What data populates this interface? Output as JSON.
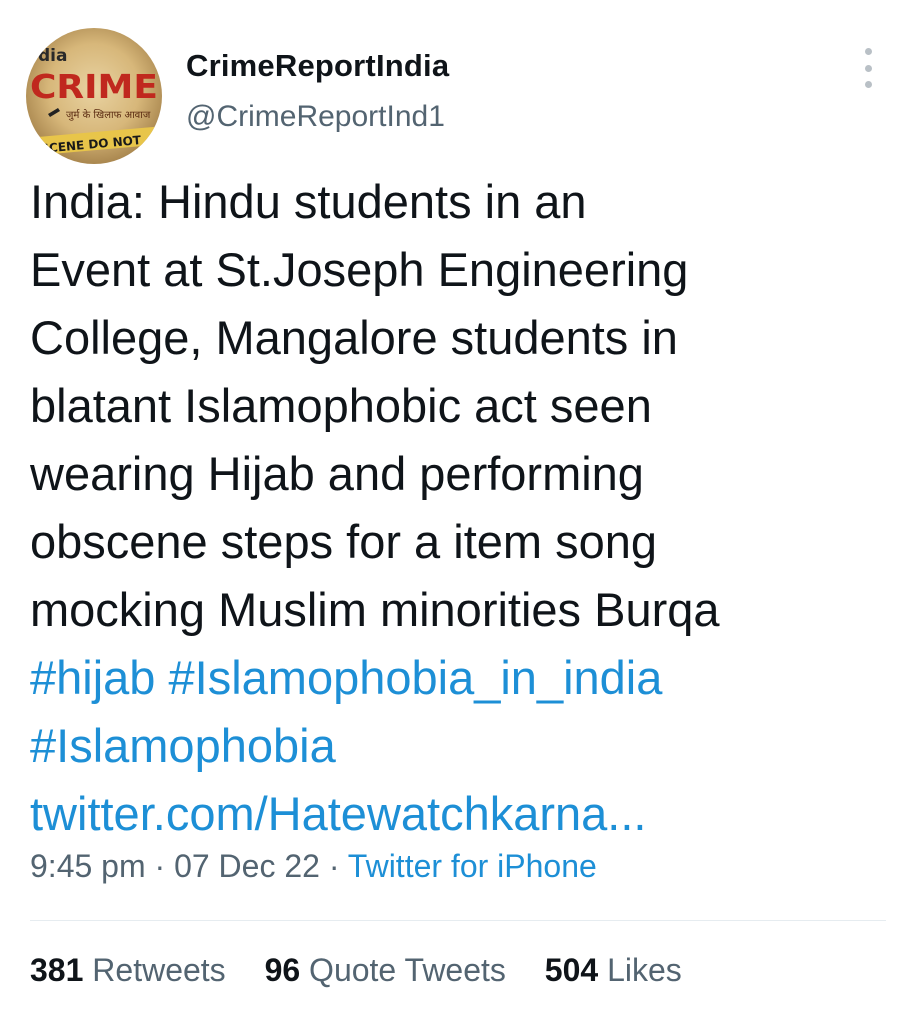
{
  "author": {
    "name": "CrimeReportIndia",
    "handle": "@CrimeReportInd1",
    "avatar": {
      "top_text": "dia",
      "logo_text": "CRIME",
      "tagline": "जुर्म के खिलाफ आवाज",
      "tape_text": "SCENE DO NOT"
    }
  },
  "tweet": {
    "lines": [
      "India: Hindu students in an",
      "Event at St.Joseph Engineering",
      "College, Mangalore students in",
      "blatant Islamophobic act seen",
      "wearing Hijab and performing",
      "obscene steps for a item song",
      "mocking Muslim minorities Burqa"
    ],
    "hashtags": [
      "#hijab",
      "#Islamophobia_in_india",
      "#Islamophobia"
    ],
    "link": "twitter.com/Hatewatchkarna..."
  },
  "meta": {
    "time": "9:45 pm",
    "separator": "·",
    "date": "07 Dec 22",
    "source": "Twitter for iPhone"
  },
  "stats": {
    "retweets_count": "381",
    "retweets_label": "Retweets",
    "quotes_count": "96",
    "quotes_label": "Quote Tweets",
    "likes_count": "504",
    "likes_label": "Likes"
  },
  "colors": {
    "link": "#1d8fd6",
    "text": "#0f1419",
    "muted": "#536471",
    "logo_red": "#c0281e"
  },
  "icons": {
    "more": "more-vertical-icon"
  }
}
